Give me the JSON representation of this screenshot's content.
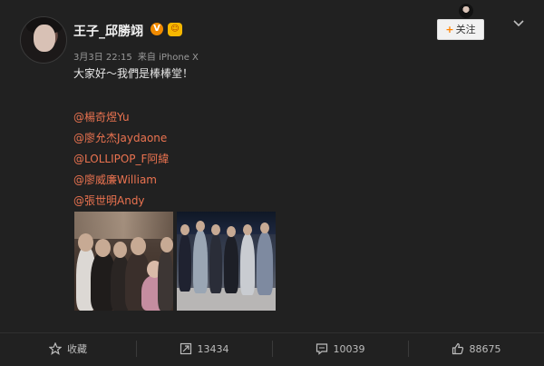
{
  "post": {
    "username": "王子_邱勝翊",
    "verified_badge": "V",
    "level_badge": "☺",
    "date": "3月3日 22:15",
    "source": "来自 iPhone X",
    "text": "大家好～我們是棒棒堂！",
    "mentions": [
      "@楊奇煜Yu",
      "@廖允杰Jaydaone",
      "@LOLLIPOP_F阿緯",
      "@廖威廉William",
      "@張世明Andy"
    ],
    "follow_label": "关注",
    "follow_plus": "+",
    "mention_color": "#eb7350",
    "accent_color": "#ff8200"
  },
  "toolbar": {
    "items": [
      {
        "label": "收藏",
        "icon": "star-icon"
      },
      {
        "label": "13434",
        "icon": "repost-icon"
      },
      {
        "label": "10039",
        "icon": "comment-icon"
      },
      {
        "label": "88675",
        "icon": "like-icon"
      }
    ]
  }
}
